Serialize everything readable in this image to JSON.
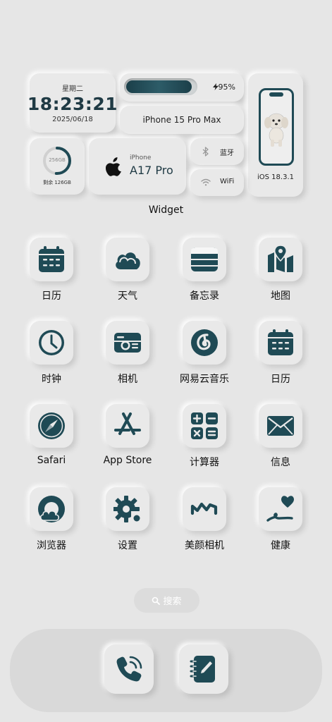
{
  "widgets": {
    "weekday": "星期二",
    "time": "18:23:21",
    "date": "2025/06/18",
    "battery_pct": "95%",
    "battery_level": 0.95,
    "model": "iPhone 15 Pro Max",
    "os_version": "iOS 18.3.1",
    "storage_total": "256GB",
    "storage_remaining": "剩余 126GB",
    "storage_used_fraction": 0.51,
    "chip_brand": "iPhone",
    "chip_name": "A17 Pro",
    "bluetooth_label": "蓝牙",
    "wifi_label": "WiFi"
  },
  "widget_title": "Widget",
  "apps": [
    {
      "label": "日历",
      "icon": "calendar-icon"
    },
    {
      "label": "天气",
      "icon": "cloud-icon"
    },
    {
      "label": "备忘录",
      "icon": "notes-icon"
    },
    {
      "label": "地图",
      "icon": "map-icon"
    },
    {
      "label": "时钟",
      "icon": "clock-icon"
    },
    {
      "label": "相机",
      "icon": "camera-icon"
    },
    {
      "label": "网易云音乐",
      "icon": "netease-music-icon"
    },
    {
      "label": "日历",
      "icon": "calendar-icon"
    },
    {
      "label": "Safari",
      "icon": "compass-icon"
    },
    {
      "label": "App Store",
      "icon": "app-store-icon"
    },
    {
      "label": "计算器",
      "icon": "calculator-icon"
    },
    {
      "label": "信息",
      "icon": "mail-icon"
    },
    {
      "label": "浏览器",
      "icon": "browser-icon"
    },
    {
      "label": "设置",
      "icon": "gear-icon"
    },
    {
      "label": "美颜相机",
      "icon": "beauty-camera-icon"
    },
    {
      "label": "健康",
      "icon": "heart-icon"
    }
  ],
  "search": {
    "label": "搜索",
    "icon": "search-icon"
  },
  "dock": [
    {
      "icon": "phone-icon"
    },
    {
      "icon": "notebook-icon"
    }
  ],
  "colors": {
    "accent": "#1f4a55",
    "background": "#e6e6e6"
  }
}
